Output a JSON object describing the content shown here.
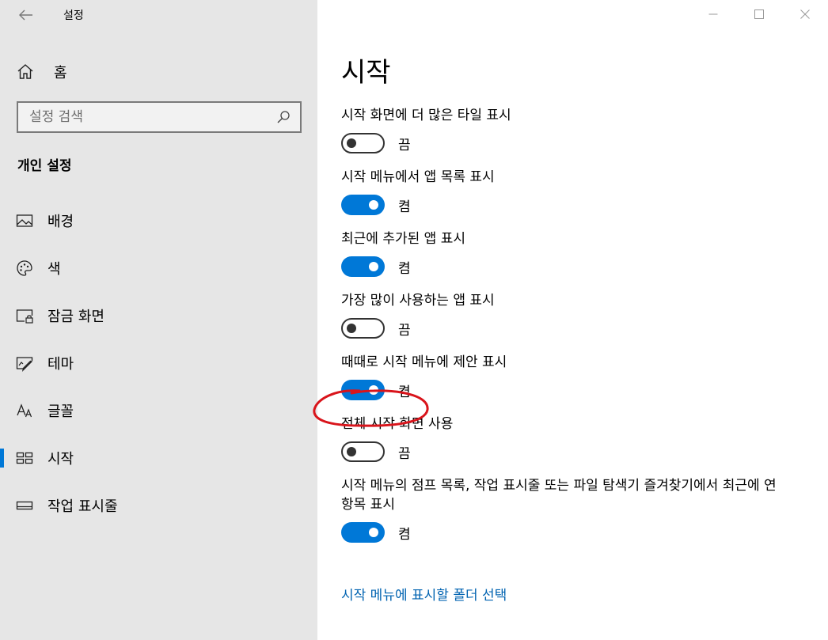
{
  "window": {
    "title": "설정"
  },
  "sidebar": {
    "home_label": "홈",
    "search_placeholder": "설정 검색",
    "section_title": "개인 설정",
    "items": [
      {
        "label": "배경",
        "icon": "picture-icon"
      },
      {
        "label": "색",
        "icon": "palette-icon"
      },
      {
        "label": "잠금 화면",
        "icon": "lock-screen-icon"
      },
      {
        "label": "테마",
        "icon": "theme-icon"
      },
      {
        "label": "글꼴",
        "icon": "font-icon"
      },
      {
        "label": "시작",
        "icon": "start-icon",
        "active": true
      },
      {
        "label": "작업 표시줄",
        "icon": "taskbar-icon"
      }
    ]
  },
  "main": {
    "title": "시작",
    "settings": [
      {
        "label": "시작 화면에 더 많은 타일 표시",
        "state": "끔",
        "on": false
      },
      {
        "label": "시작 메뉴에서 앱 목록 표시",
        "state": "켬",
        "on": true
      },
      {
        "label": "최근에 추가된 앱 표시",
        "state": "켬",
        "on": true
      },
      {
        "label": "가장 많이 사용하는 앱 표시",
        "state": "끔",
        "on": false
      },
      {
        "label": "때때로 시작 메뉴에 제안 표시",
        "state": "켬",
        "on": true,
        "annotated": true
      },
      {
        "label": "전체 시작 화면 사용",
        "state": "끔",
        "on": false
      },
      {
        "label": "시작 메뉴의 점프 목록, 작업 표시줄 또는 파일 탐색기 즐겨찾기에서 최근에 연 항목 표시",
        "state": "켬",
        "on": true
      }
    ],
    "link_label": "시작 메뉴에 표시할 폴더 선택"
  },
  "colors": {
    "accent": "#0078d7",
    "link": "#0063b1",
    "sidebar_bg": "#e6e6e6",
    "annotation": "#d9141b"
  }
}
